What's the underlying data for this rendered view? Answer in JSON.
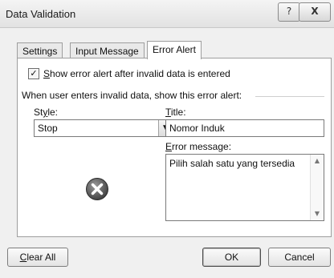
{
  "window": {
    "title": "Data Validation",
    "help_glyph": "?",
    "close_glyph": "X"
  },
  "tabs": [
    {
      "label": "Settings",
      "active": false
    },
    {
      "label": "Input Message",
      "active": false
    },
    {
      "label": "Error Alert",
      "active": true
    }
  ],
  "error_alert": {
    "show_checkbox": {
      "checked": true,
      "label_key": "S",
      "label_rest": "how error alert after invalid data is entered"
    },
    "group_label": "When user enters invalid data, show this error alert:",
    "style": {
      "label_pre": "St",
      "label_key": "y",
      "label_post": "le:",
      "value": "Stop"
    },
    "title": {
      "label_key": "T",
      "label_rest": "itle:",
      "value": "Nomor Induk"
    },
    "error_message": {
      "label_key": "E",
      "label_rest": "rror message:",
      "value": "Pilih salah satu yang tersedia"
    },
    "icon": "stop-error-icon"
  },
  "buttons": {
    "clear_key": "C",
    "clear_rest": "lear All",
    "ok": "OK",
    "cancel": "Cancel"
  }
}
